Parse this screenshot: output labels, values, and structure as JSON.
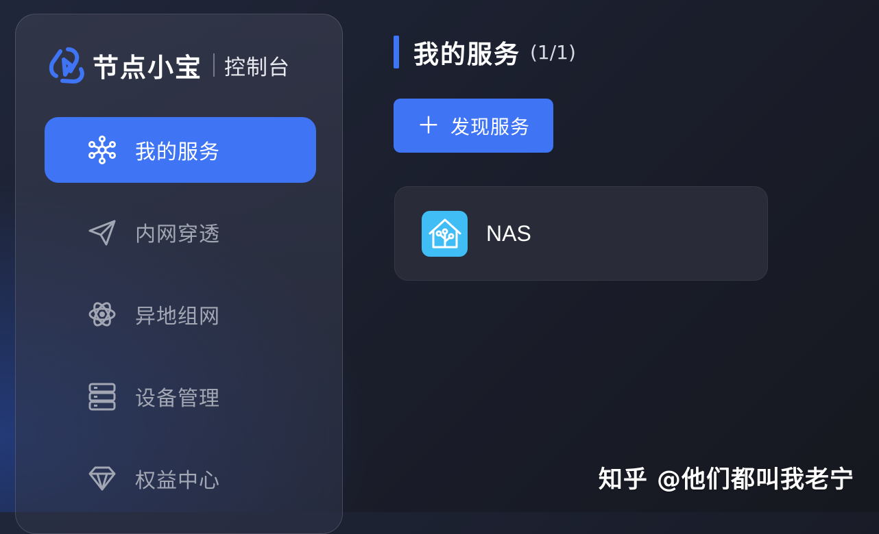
{
  "sidebar": {
    "logo": {
      "name": "节点小宝",
      "sub": "控制台",
      "icon": "logo-knot-icon"
    },
    "items": [
      {
        "label": "我的服务",
        "icon": "network-nodes-icon",
        "active": true
      },
      {
        "label": "内网穿透",
        "icon": "paper-plane-icon",
        "active": false
      },
      {
        "label": "异地组网",
        "icon": "atom-orbit-icon",
        "active": false
      },
      {
        "label": "设备管理",
        "icon": "server-stack-icon",
        "active": false
      },
      {
        "label": "权益中心",
        "icon": "diamond-icon",
        "active": false
      }
    ]
  },
  "main": {
    "title": "我的服务",
    "count": "(1/1)",
    "discover_button": {
      "icon": "plus-icon",
      "label": "发现服务"
    },
    "services": [
      {
        "name": "NAS",
        "icon": "home-assistant-icon"
      }
    ]
  },
  "watermark": "知乎 @他们都叫我老宁",
  "colors": {
    "accent": "#3f74f5",
    "service_icon_bg": "#41bdf5",
    "inactive_text": "#a3a7b4",
    "card_bg": "#292c38"
  }
}
